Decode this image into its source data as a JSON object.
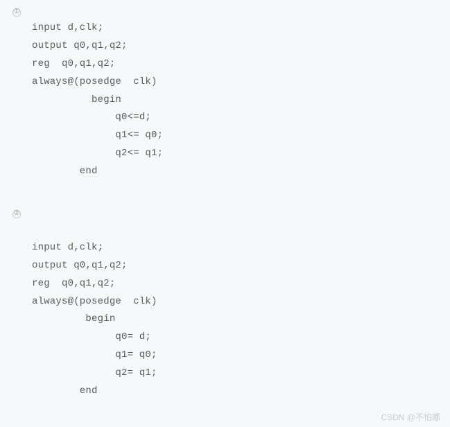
{
  "block1": {
    "marker": "①",
    "lines": {
      "l1": "input d,clk;",
      "l2": "output q0,q1,q2;",
      "l3": "reg  q0,q1,q2;",
      "l4": "always@(posedge  clk)",
      "l5": "          begin",
      "l6": "              q0<=d;",
      "l7": "              q1<= q0;",
      "l8": "              q2<= q1;",
      "l9": "        end"
    }
  },
  "block2": {
    "marker": "②",
    "lines": {
      "l1": "input d,clk;",
      "l2": "output q0,q1,q2;",
      "l3": "reg  q0,q1,q2;",
      "l4": "always@(posedge  clk)",
      "l5": "         begin",
      "l6": "              q0= d;",
      "l7": "              q1= q0;",
      "l8": "              q2= q1;",
      "l9": "        end"
    }
  },
  "watermark": "CSDN @不怕娜"
}
